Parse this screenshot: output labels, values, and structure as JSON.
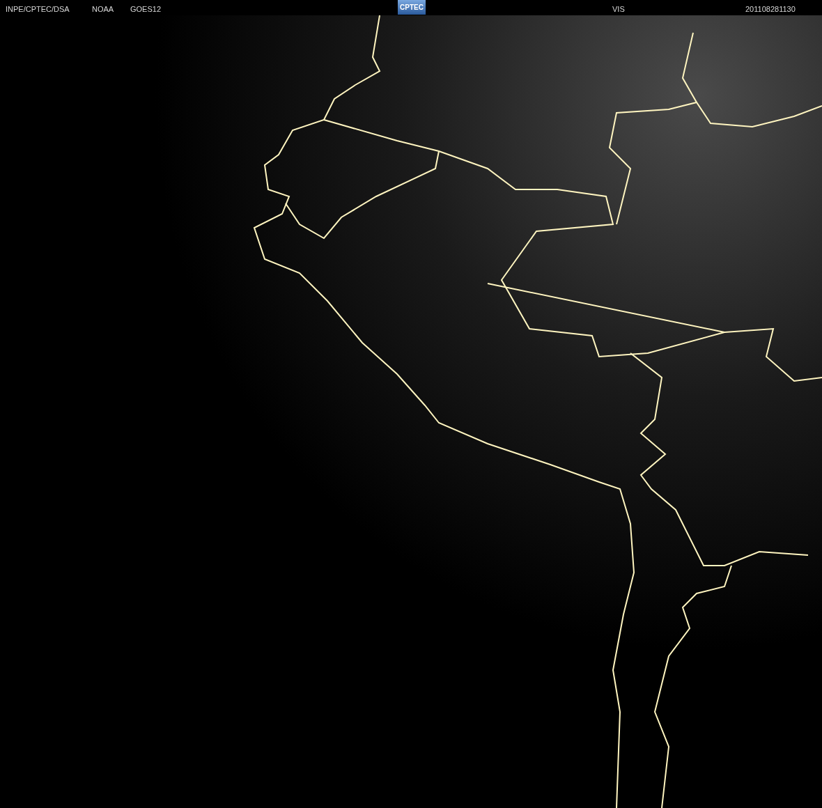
{
  "header": {
    "source": "INPE/CPTEC/DSA",
    "agency": "NOAA",
    "satellite": "GOES12",
    "logo": "CPTEC",
    "channel": "VIS",
    "timestamp": "201108281130"
  }
}
